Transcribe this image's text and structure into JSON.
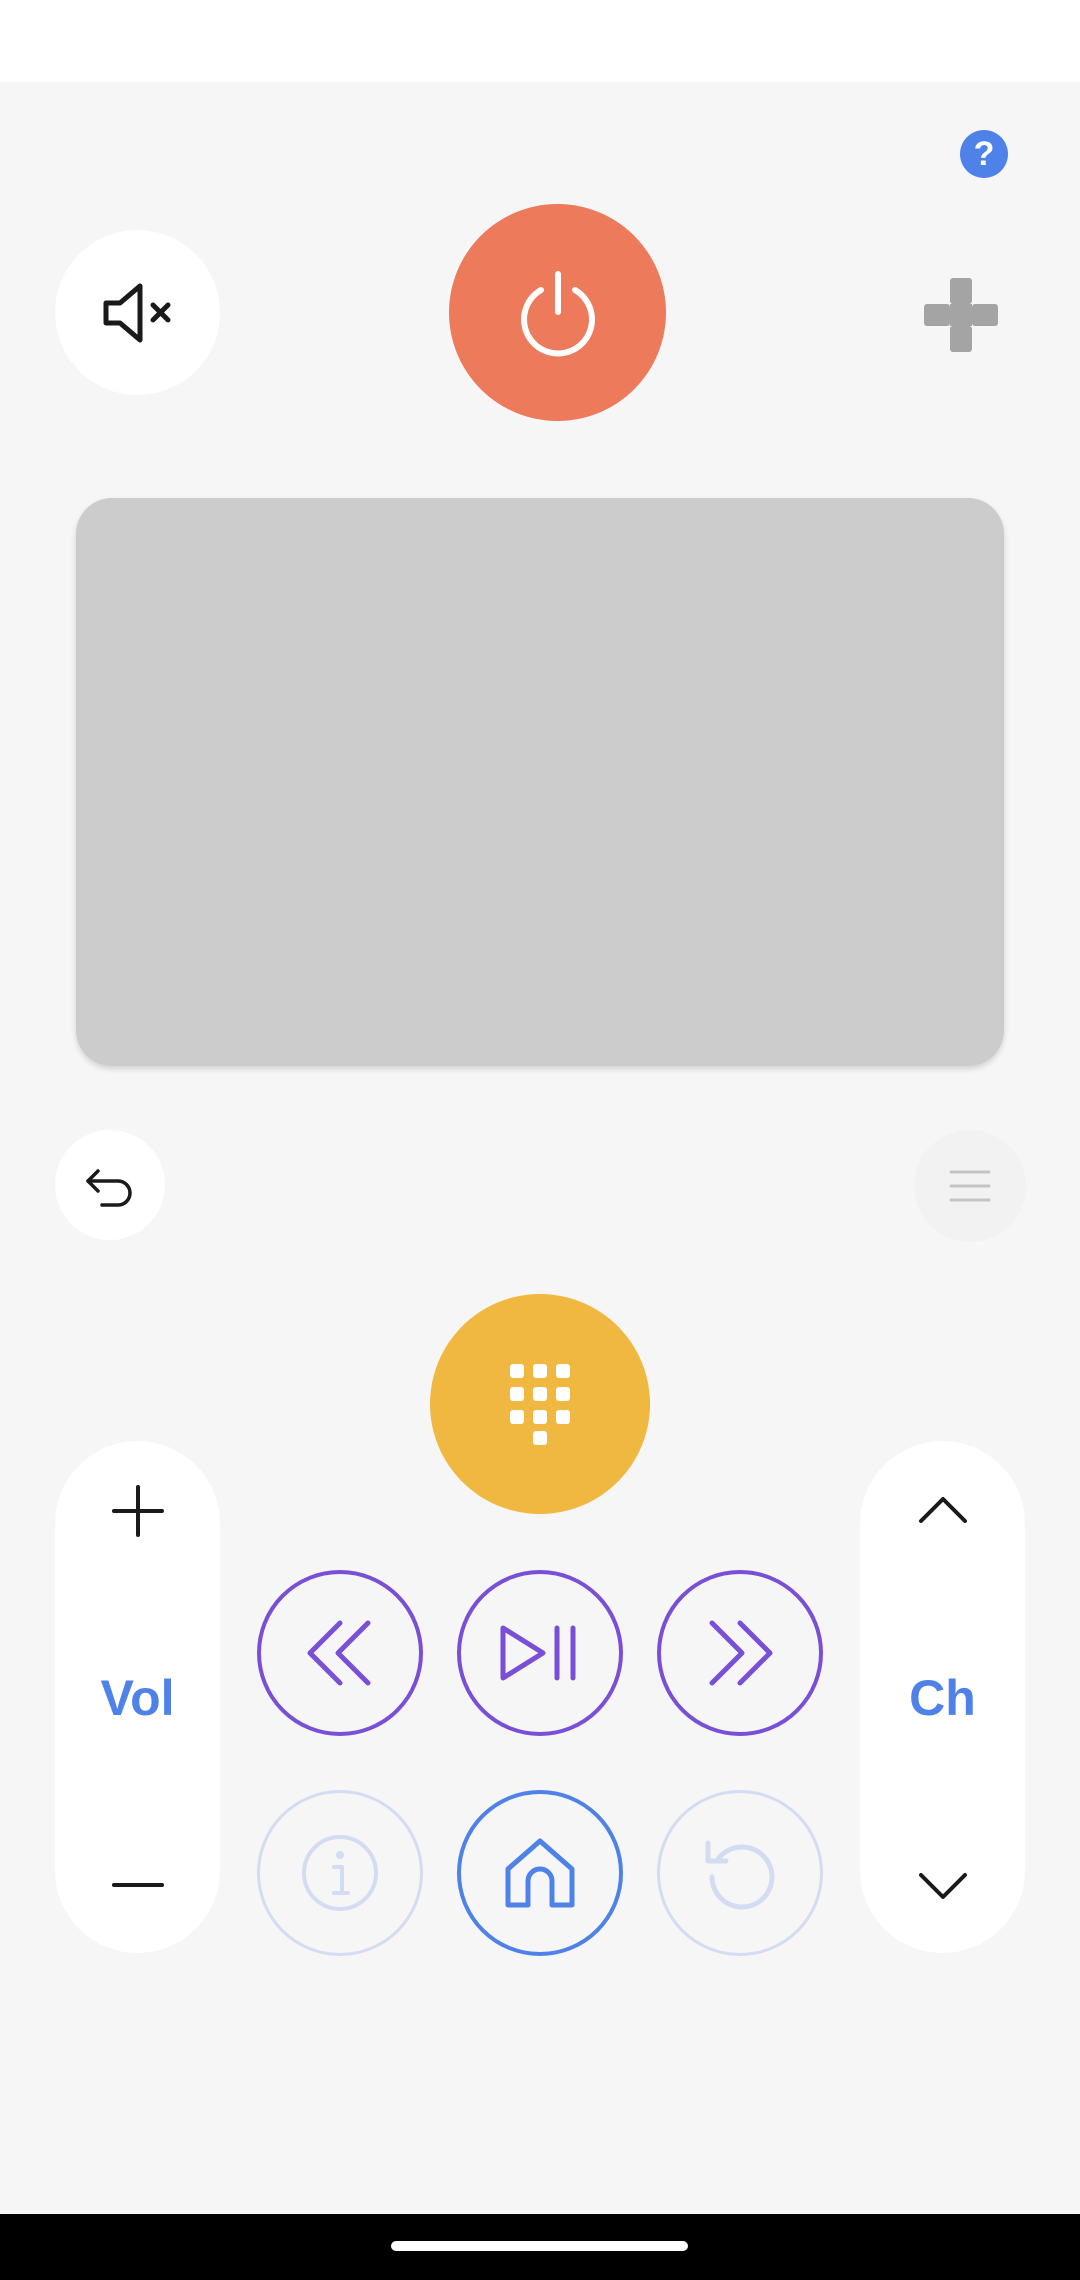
{
  "header": {
    "help_label": "?"
  },
  "remote": {
    "vol_label": "Vol",
    "ch_label": "Ch"
  },
  "colors": {
    "power": "#ec7a5b",
    "numpad": "#f0b840",
    "accent_blue": "#4f82e8",
    "media_purple": "#7a4fd8",
    "touchpad": "#cccccc",
    "disabled": "#d3dcf3"
  },
  "icons": {
    "help": "help-icon",
    "mute": "volume-mute-icon",
    "power": "power-icon",
    "gamepad": "dpad-icon",
    "back": "back-icon",
    "menu": "menu-icon",
    "numpad": "numpad-icon",
    "vol_up": "plus-icon",
    "vol_down": "minus-icon",
    "ch_up": "chevron-up-icon",
    "ch_down": "chevron-down-icon",
    "rewind": "rewind-icon",
    "play_pause": "play-pause-icon",
    "fast_forward": "fast-forward-icon",
    "info": "info-icon",
    "home": "home-icon",
    "replay": "replay-icon"
  }
}
